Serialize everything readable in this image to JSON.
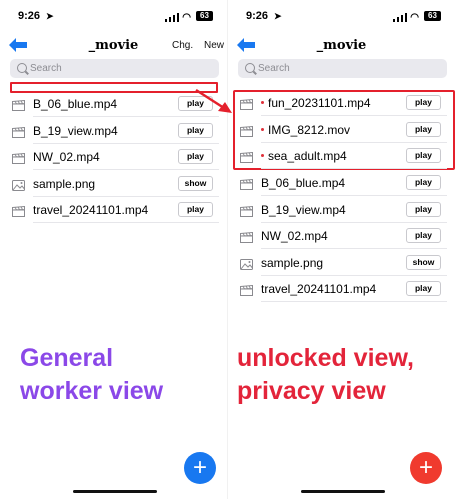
{
  "left": {
    "status_bar": {
      "time": "9:26",
      "battery": "63"
    },
    "title": "_movie",
    "header_buttons": {
      "change": "Chg.",
      "new": "New"
    },
    "search": {
      "placeholder": "Search"
    },
    "files": [
      {
        "name": "B_06_blue.mp4",
        "action": "play",
        "icon": "clapperboard-icon"
      },
      {
        "name": "B_19_view.mp4",
        "action": "play",
        "icon": "clapperboard-icon"
      },
      {
        "name": "NW_02.mp4",
        "action": "play",
        "icon": "clapperboard-icon"
      },
      {
        "name": "sample.png",
        "action": "show",
        "icon": "image-icon"
      },
      {
        "name": "travel_20241101.mp4",
        "action": "play",
        "icon": "clapperboard-icon"
      }
    ],
    "caption": [
      "General",
      "worker view"
    ],
    "fab": "+"
  },
  "right": {
    "status_bar": {
      "time": "9:26",
      "battery": "63"
    },
    "title": "_movie",
    "search": {
      "placeholder": "Search"
    },
    "private_files": [
      {
        "name": "fun_20231101.mp4",
        "action": "play",
        "icon": "clapperboard-icon"
      },
      {
        "name": "IMG_8212.mov",
        "action": "play",
        "icon": "clapperboard-icon"
      },
      {
        "name": "sea_adult.mp4",
        "action": "play",
        "icon": "clapperboard-icon"
      }
    ],
    "files": [
      {
        "name": "B_06_blue.mp4",
        "action": "play",
        "icon": "clapperboard-icon"
      },
      {
        "name": "B_19_view.mp4",
        "action": "play",
        "icon": "clapperboard-icon"
      },
      {
        "name": "NW_02.mp4",
        "action": "play",
        "icon": "clapperboard-icon"
      },
      {
        "name": "sample.png",
        "action": "show",
        "icon": "image-icon"
      },
      {
        "name": "travel_20241101.mp4",
        "action": "play",
        "icon": "clapperboard-icon"
      }
    ],
    "caption": [
      "unlocked view,",
      "privacy view"
    ],
    "fab": "+"
  },
  "colors": {
    "accent_blue": "#1878f0",
    "fab_red": "#f03a2e",
    "highlight_red": "#e4202c",
    "caption_purple": "#8b48e8",
    "caption_red": "#e3243a",
    "private_dot": "#e0303a"
  }
}
